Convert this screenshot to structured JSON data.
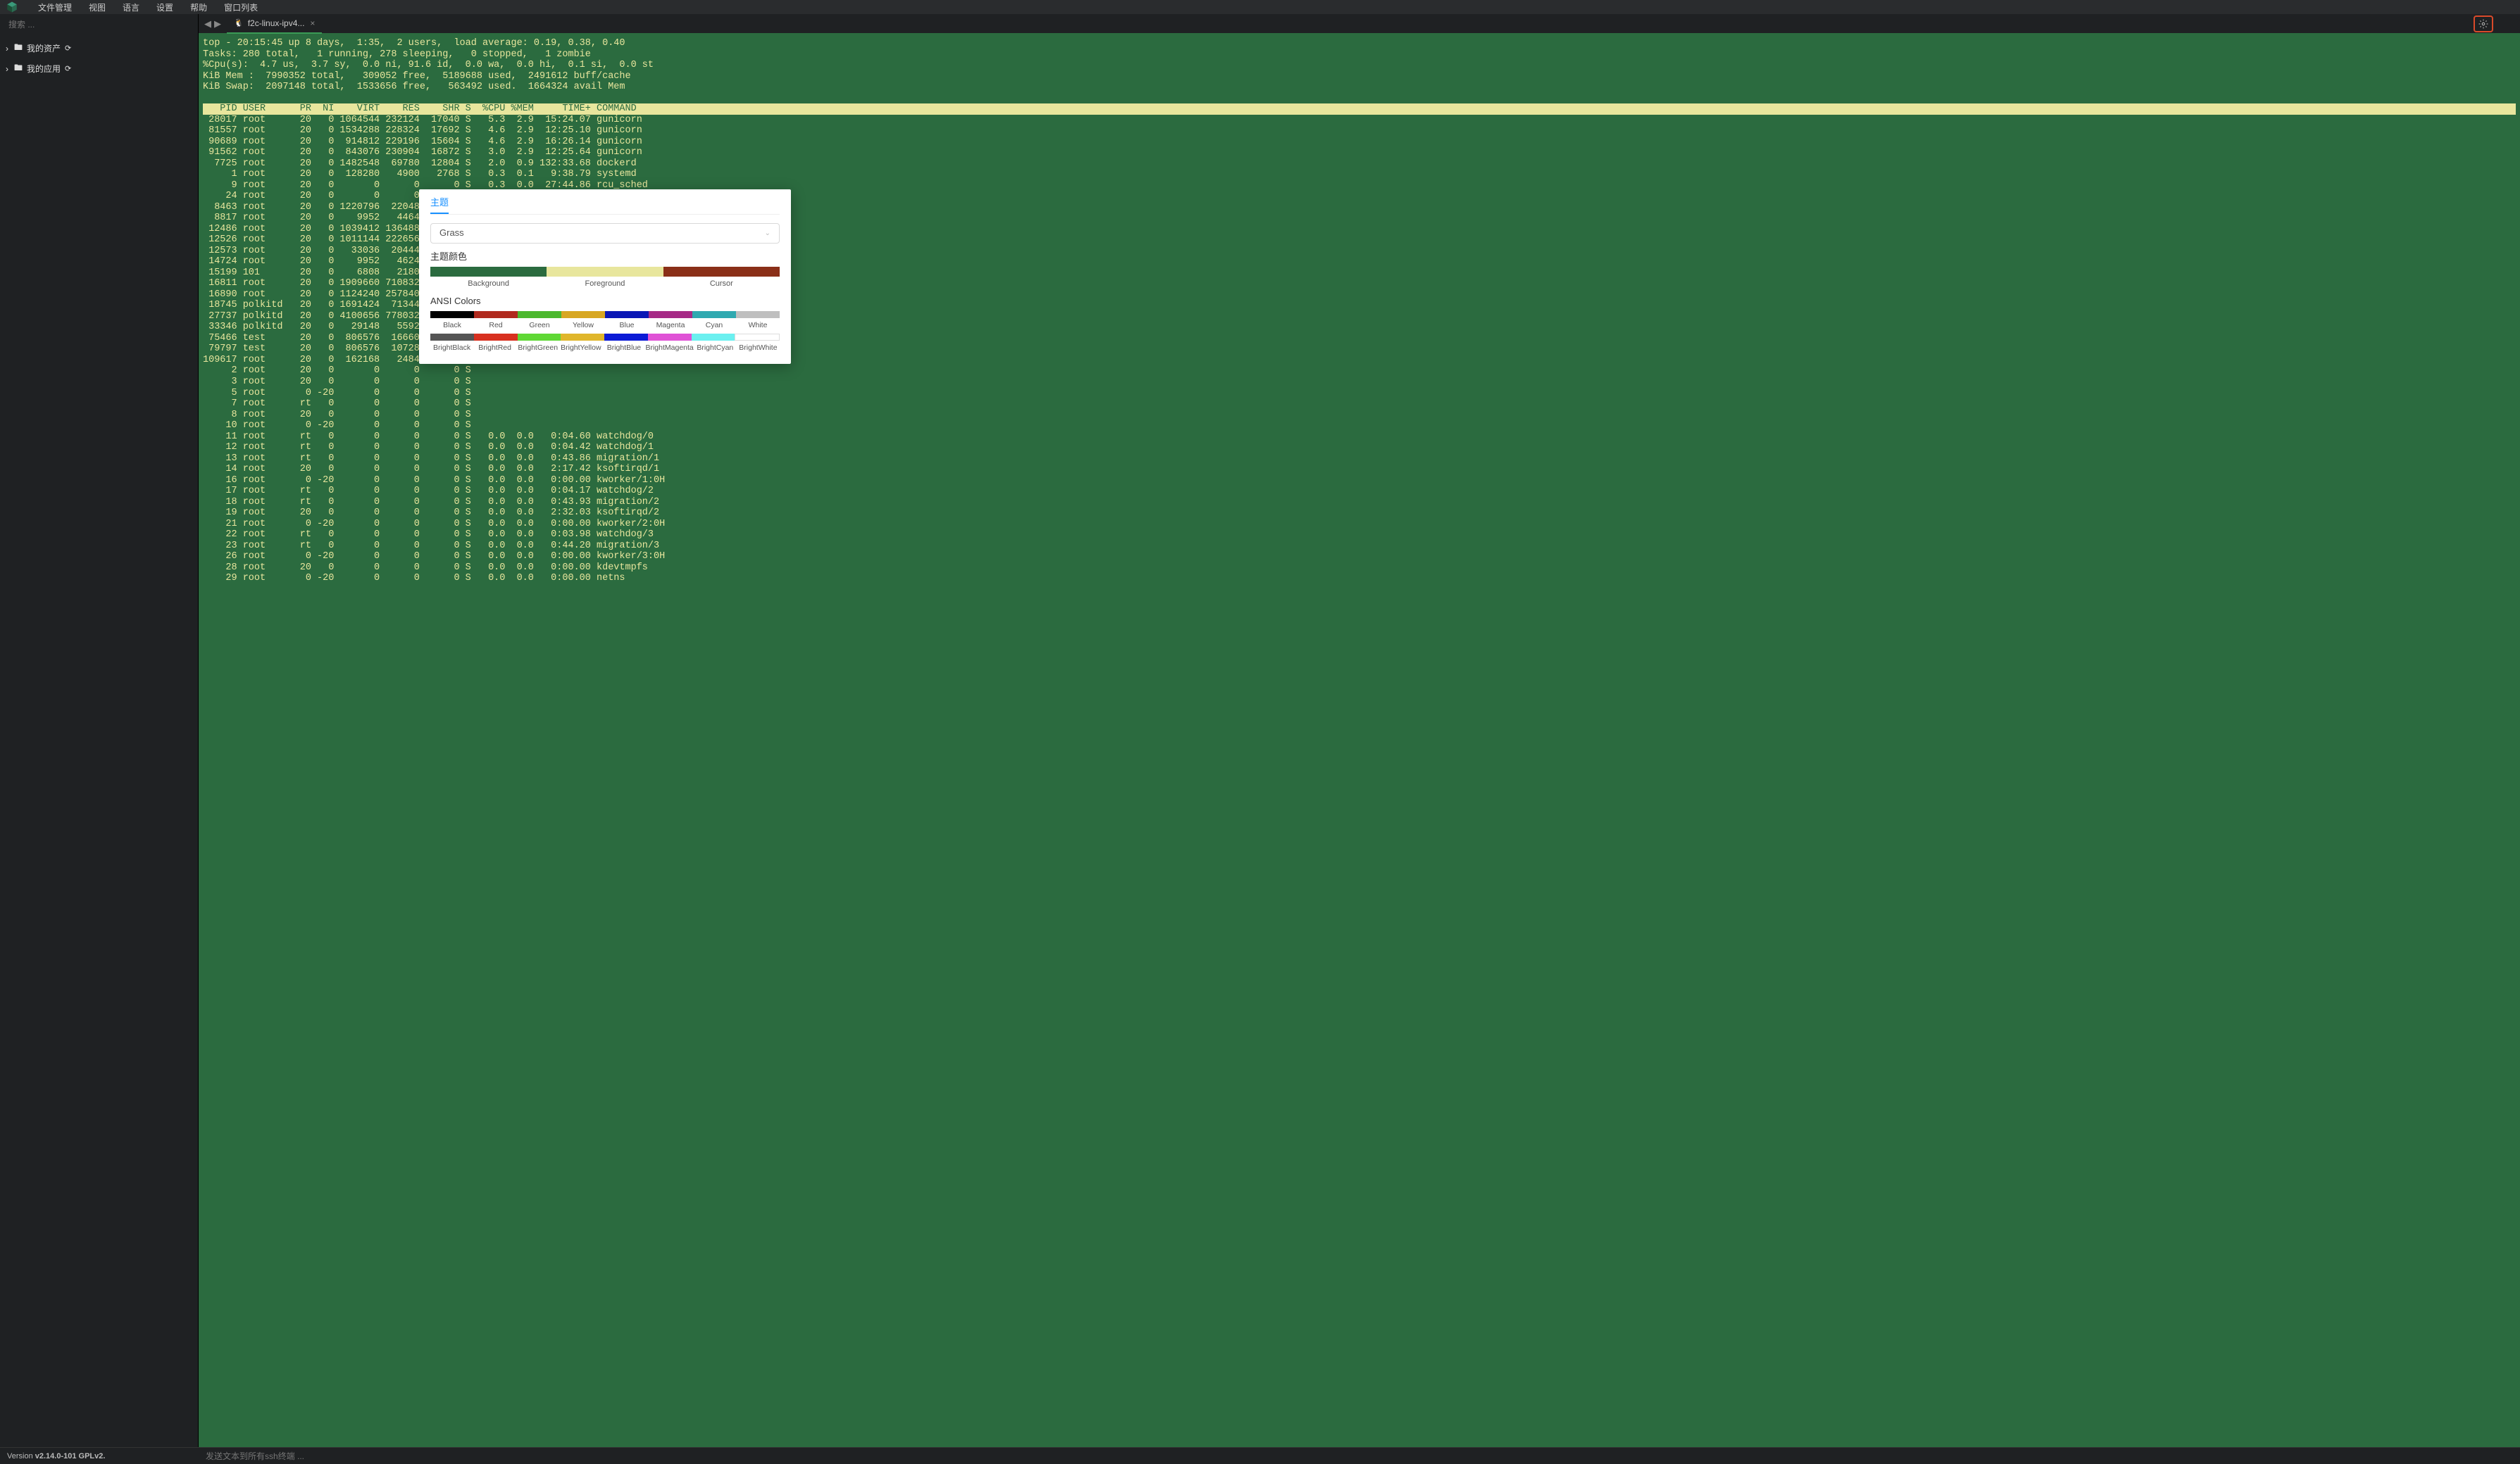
{
  "menu": {
    "items": [
      "文件管理",
      "视图",
      "语言",
      "设置",
      "帮助",
      "窗口列表"
    ]
  },
  "sidebar": {
    "search_placeholder": "搜索 ...",
    "items": [
      {
        "label": "我的资产"
      },
      {
        "label": "我的应用"
      }
    ]
  },
  "tab": {
    "title": "f2c-linux-ipv4..."
  },
  "terminal": {
    "top_lines": [
      "top - 20:15:45 up 8 days,  1:35,  2 users,  load average: 0.19, 0.38, 0.40",
      "Tasks: 280 total,   1 running, 278 sleeping,   0 stopped,   1 zombie",
      "%Cpu(s):  4.7 us,  3.7 sy,  0.0 ni, 91.6 id,  0.0 wa,  0.0 hi,  0.1 si,  0.0 st",
      "KiB Mem :  7990352 total,   309052 free,  5189688 used,  2491612 buff/cache",
      "KiB Swap:  2097148 total,  1533656 free,   563492 used.  1664324 avail Mem"
    ],
    "header": "   PID USER      PR  NI    VIRT    RES    SHR S  %CPU %MEM     TIME+ COMMAND",
    "rows": [
      " 28017 root      20   0 1064544 232124  17040 S   5.3  2.9  15:24.07 gunicorn",
      " 81557 root      20   0 1534288 228324  17692 S   4.6  2.9  12:25.10 gunicorn",
      " 90689 root      20   0  914812 229196  15604 S   4.6  2.9  16:26.14 gunicorn",
      " 91562 root      20   0  843076 230904  16872 S   3.0  2.9  12:25.64 gunicorn",
      "  7725 root      20   0 1482548  69780  12804 S   2.0  0.9 132:33.68 dockerd",
      "     1 root      20   0  128280   4900   2768 S   0.3  0.1   9:38.79 systemd",
      "     9 root      20   0       0      0      0 S   0.3  0.0  27:44.86 rcu_sched",
      "    24 root      20   0       0      0      0 S",
      "  8463 root      20   0 1220796  22048   5672 S",
      "  8817 root      20   0    9952   4464   2872 S",
      " 12486 root      20   0 1039412 136488  14256 S",
      " 12526 root      20   0 1011144 222656  17372 S",
      " 12573 root      20   0   33036  20444   4932 S",
      " 14724 root      20   0    9952   4624   2836 S",
      " 15199 101       20   0    6808   2180    592 S",
      " 16811 root      20   0 1909660 710832  28912 S",
      " 16890 root      20   0 1124240 257840  24668 S",
      " 18745 polkitd   20   0 1691424  71344   2068 S",
      " 27737 polkitd   20   0 4100656 778032   7552 S",
      " 33346 polkitd   20   0   29148   5592    576 S",
      " 75466 test      20   0  806576  16660  14664 S",
      " 79797 test      20   0  806576  10728   8764 S",
      "109617 root      20   0  162168   2484   1596 R",
      "     2 root      20   0       0      0      0 S",
      "     3 root      20   0       0      0      0 S",
      "     5 root       0 -20       0      0      0 S",
      "     7 root      rt   0       0      0      0 S",
      "     8 root      20   0       0      0      0 S",
      "    10 root       0 -20       0      0      0 S",
      "    11 root      rt   0       0      0      0 S   0.0  0.0   0:04.60 watchdog/0",
      "    12 root      rt   0       0      0      0 S   0.0  0.0   0:04.42 watchdog/1",
      "    13 root      rt   0       0      0      0 S   0.0  0.0   0:43.86 migration/1",
      "    14 root      20   0       0      0      0 S   0.0  0.0   2:17.42 ksoftirqd/1",
      "    16 root       0 -20       0      0      0 S   0.0  0.0   0:00.00 kworker/1:0H",
      "    17 root      rt   0       0      0      0 S   0.0  0.0   0:04.17 watchdog/2",
      "    18 root      rt   0       0      0      0 S   0.0  0.0   0:43.93 migration/2",
      "    19 root      20   0       0      0      0 S   0.0  0.0   2:32.03 ksoftirqd/2",
      "    21 root       0 -20       0      0      0 S   0.0  0.0   0:00.00 kworker/2:0H",
      "    22 root      rt   0       0      0      0 S   0.0  0.0   0:03.98 watchdog/3",
      "    23 root      rt   0       0      0      0 S   0.0  0.0   0:44.20 migration/3",
      "    26 root       0 -20       0      0      0 S   0.0  0.0   0:00.00 kworker/3:0H",
      "    28 root      20   0       0      0      0 S   0.0  0.0   0:00.00 kdevtmpfs",
      "    29 root       0 -20       0      0      0 S   0.0  0.0   0:00.00 netns"
    ]
  },
  "popup": {
    "tab": "主题",
    "theme_value": "Grass",
    "theme_colors_label": "主题颜色",
    "theme_swatches": [
      {
        "color": "#2b6b3f",
        "label": "Background"
      },
      {
        "color": "#e8e69d",
        "label": "Foreground"
      },
      {
        "color": "#8a2f18",
        "label": "Cursor"
      }
    ],
    "ansi_label": "ANSI Colors",
    "ansi_normal": [
      {
        "color": "#000000",
        "label": "Black"
      },
      {
        "color": "#b02a1e",
        "label": "Red"
      },
      {
        "color": "#4cb82e",
        "label": "Green"
      },
      {
        "color": "#d8a722",
        "label": "Yellow"
      },
      {
        "color": "#0a17b5",
        "label": "Blue"
      },
      {
        "color": "#a62a86",
        "label": "Magenta"
      },
      {
        "color": "#2fa9b0",
        "label": "Cyan"
      },
      {
        "color": "#bfbfbf",
        "label": "White"
      }
    ],
    "ansi_bright": [
      {
        "color": "#555555",
        "label": "BrightBlack"
      },
      {
        "color": "#d8301f",
        "label": "BrightRed"
      },
      {
        "color": "#5fd835",
        "label": "BrightGreen"
      },
      {
        "color": "#e0b62b",
        "label": "BrightYellow"
      },
      {
        "color": "#0c1ad6",
        "label": "BrightBlue"
      },
      {
        "color": "#e052d6",
        "label": "BrightMagenta"
      },
      {
        "color": "#6bf0f0",
        "label": "BrightCyan"
      },
      {
        "color": "#ffffff",
        "label": "BrightWhite"
      }
    ]
  },
  "footer": {
    "version_prefix": "Version ",
    "version_value": "v2.14.0-101 GPLv2.",
    "send_placeholder": "发送文本到所有ssh终端 ..."
  }
}
